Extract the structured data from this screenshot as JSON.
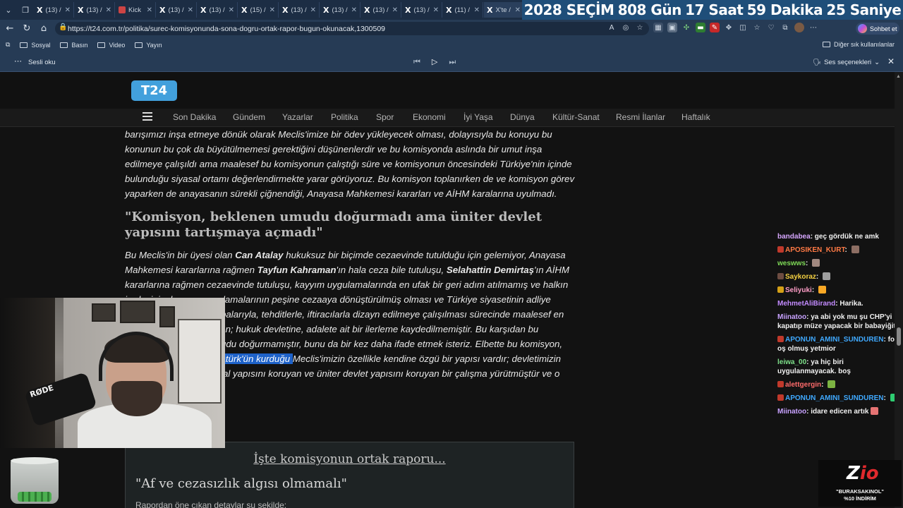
{
  "browser": {
    "tabs": [
      {
        "icon": "X",
        "label": "(13) /",
        "active": false
      },
      {
        "icon": "X",
        "label": "(13) /",
        "active": false
      },
      {
        "icon": "kick",
        "label": "Kick",
        "active": false
      },
      {
        "icon": "X",
        "label": "(13) /",
        "active": false
      },
      {
        "icon": "X",
        "label": "(13) /",
        "active": false
      },
      {
        "icon": "X",
        "label": "(15) /",
        "active": false
      },
      {
        "icon": "X",
        "label": "(13) /",
        "active": false
      },
      {
        "icon": "X",
        "label": "(13) /",
        "active": false
      },
      {
        "icon": "X",
        "label": "(13) /",
        "active": false
      },
      {
        "icon": "X",
        "label": "(13) /",
        "active": false
      },
      {
        "icon": "X",
        "label": "(11) /",
        "active": false
      },
      {
        "icon": "X",
        "label": "X'te /",
        "active": true
      }
    ],
    "url": "https://t24.com.tr/politika/surec-komisyonunda-sona-dogru-ortak-rapor-bugun-okunacak,1300509",
    "chat_button": "Sohbet et",
    "bookmarks": [
      "Sosyal",
      "Basın",
      "Video",
      "Yayın"
    ],
    "other_bookmarks": "Diğer sık kullanılanlar"
  },
  "countdown": {
    "items": [
      "2028 SEÇİM",
      "808 Gün",
      "17 Saat",
      "59 Dakika",
      "25 Saniye"
    ],
    "bg_color": "#1f4e79"
  },
  "read_aloud": {
    "label": "Sesli oku",
    "voice_options": "Ses seçenekleri"
  },
  "site": {
    "logo": "T24",
    "logo_color": "#42a0dc",
    "nav": [
      "Son Dakika",
      "Gündem",
      "Yazarlar",
      "Politika",
      "Spor",
      "Ekonomi",
      "İyi Yaşa",
      "Dünya",
      "Kültür-Sanat",
      "Resmi İlanlar",
      "Haftalık"
    ]
  },
  "article": {
    "para1": "barışımızı inşa etmeye dönük olarak Meclis'imize bir ödev yükleyecek olması, dolayısıyla bu konuyu bu konunun bu çok da büyütülmemesi gerektiğini düşünenlerdir ve bu komisyonda aslında bir umut inşa edilmeye çalışıldı ama maalesef bu komisyonun çalıştığı süre ve komisyonun öncesindeki Türkiye'nin içinde bulunduğu siyasal ortamı değerlendirmekte yarar görüyoruz. Bu komisyon toplanırken de ve komisyon görev yaparken de anayasanın sürekli çiğnendiği, Anayasa Mahkemesi kararları ve AİHM karalarına uyulmadı.",
    "subhead": "\"Komisyon, beklenen umudu doğurmadı ama üniter devlet yapısını tartışmaya açmadı\"",
    "p2_a": "Bu Meclis'in bir üyesi olan ",
    "p2_b": "Can Atalay",
    "p2_c": " hukuksuz bir biçimde cezaevinde tutulduğu için gelemiyor, Anayasa Mahkemesi kararlarına rağmen ",
    "p2_d": "Tayfun Kahraman",
    "p2_e": "'ın hala ceza bile tutuluşu, ",
    "p2_f": "Selahattin Demirtaş",
    "p2_g": "'ın AİHM kararlarına rağmen cezaevinde tutuluşu, kayyım uygulamalarında en ufak bir geri adım atılmamış ve halkın iradesinin, kayyım uygulamalarının peşine cezaaya dönüştürülmüş olması ve Türkiye siyasetinin adliye koridorlarında, yargı sopalarıyla, tehditlerle, iftiracılarla dizayn edilmeye çalışılması sürecinde maalesef en ufak bir iyileşme olmadan; hukuk devletine, adalete ait bir ilerleme kaydedilmemiştir. Bu karşıdan bu komisyon beklenen umudu doğurmamıştır, bunu da bir kez daha ifade etmek isteriz. Elbette bu komisyon, Gazi Mustafa ",
    "p2_h": "Kemal Atatürk'ün kurduğu ",
    "p2_i": "Meclis'imizin özellikle kendine özgü bir yapısı vardır; devletimizin demokratik, laik anayasal yapısını koruyan ve üniter devlet yapısını koruyan bir çalışma yürütmüştür ve o açıdan da değerlidir.\""
  },
  "report": {
    "link": "İşte komisyonun ortak raporu...",
    "subhead": "\"Af ve cezasızlık algısı olmamalı\"",
    "teaser": "Rapordan öne çıkan detaylar şu şekilde:"
  },
  "webcam": {
    "mic_brand": "RØDE"
  },
  "chat": [
    {
      "user": "bandabea",
      "color": "#d6a7ff",
      "text": "geç gördük ne amk",
      "badge": "",
      "emote": ""
    },
    {
      "user": "APOSIKEN_KURT",
      "color": "#ff7a45",
      "text": "",
      "badge": "#c0392b",
      "emote": "#8d6e63"
    },
    {
      "user": "weswws",
      "color": "#7ed957",
      "text": "",
      "badge": "",
      "emote": "#a1887f"
    },
    {
      "user": "Saykoraz",
      "color": "#f5d142",
      "text": "",
      "badge": "#6d4c41",
      "emote": "#9e9e9e"
    },
    {
      "user": "Seliyuki",
      "color": "#ff9ec7",
      "text": "",
      "badge": "#d4a017",
      "emote": "#f9a825"
    },
    {
      "user": "MehmetAliBirand",
      "color": "#c38bff",
      "text": "Harika.",
      "badge": "",
      "emote": ""
    },
    {
      "user": "Miinatoo",
      "color": "#c8a2ff",
      "text": "ya abi yok mu şu CHP'yi kapatıp müze yapacak bir babayiğit",
      "badge": "",
      "emote": ""
    },
    {
      "user": "APONUN_AMINI_SUNDUREN",
      "color": "#3fa9ff",
      "text": "foll oş olmuş yetmior",
      "badge": "#c0392b",
      "emote": ""
    },
    {
      "user": "leiwa_00",
      "color": "#7ee08a",
      "text": "ya hiç biri uygulanmayacak. boş",
      "badge": "",
      "emote": ""
    },
    {
      "user": "alettgergin",
      "color": "#ff6b6b",
      "text": "",
      "badge": "#c0392b",
      "emote": "#7cb342"
    },
    {
      "user": "APONUN_AMINI_SUNDUREN",
      "color": "#3fa9ff",
      "text": "",
      "badge": "#c0392b",
      "emote": "#2ecc71"
    },
    {
      "user": "Miinatoo",
      "color": "#c8a2ff",
      "text": "idare edicen artık",
      "badge": "",
      "emote": "#e57373"
    }
  ],
  "sponsor": {
    "logo_a": "Z",
    "logo_b": "io",
    "line1": "\"BURAKSAKINOL\"",
    "line2": "%10 İNDİRİM"
  }
}
